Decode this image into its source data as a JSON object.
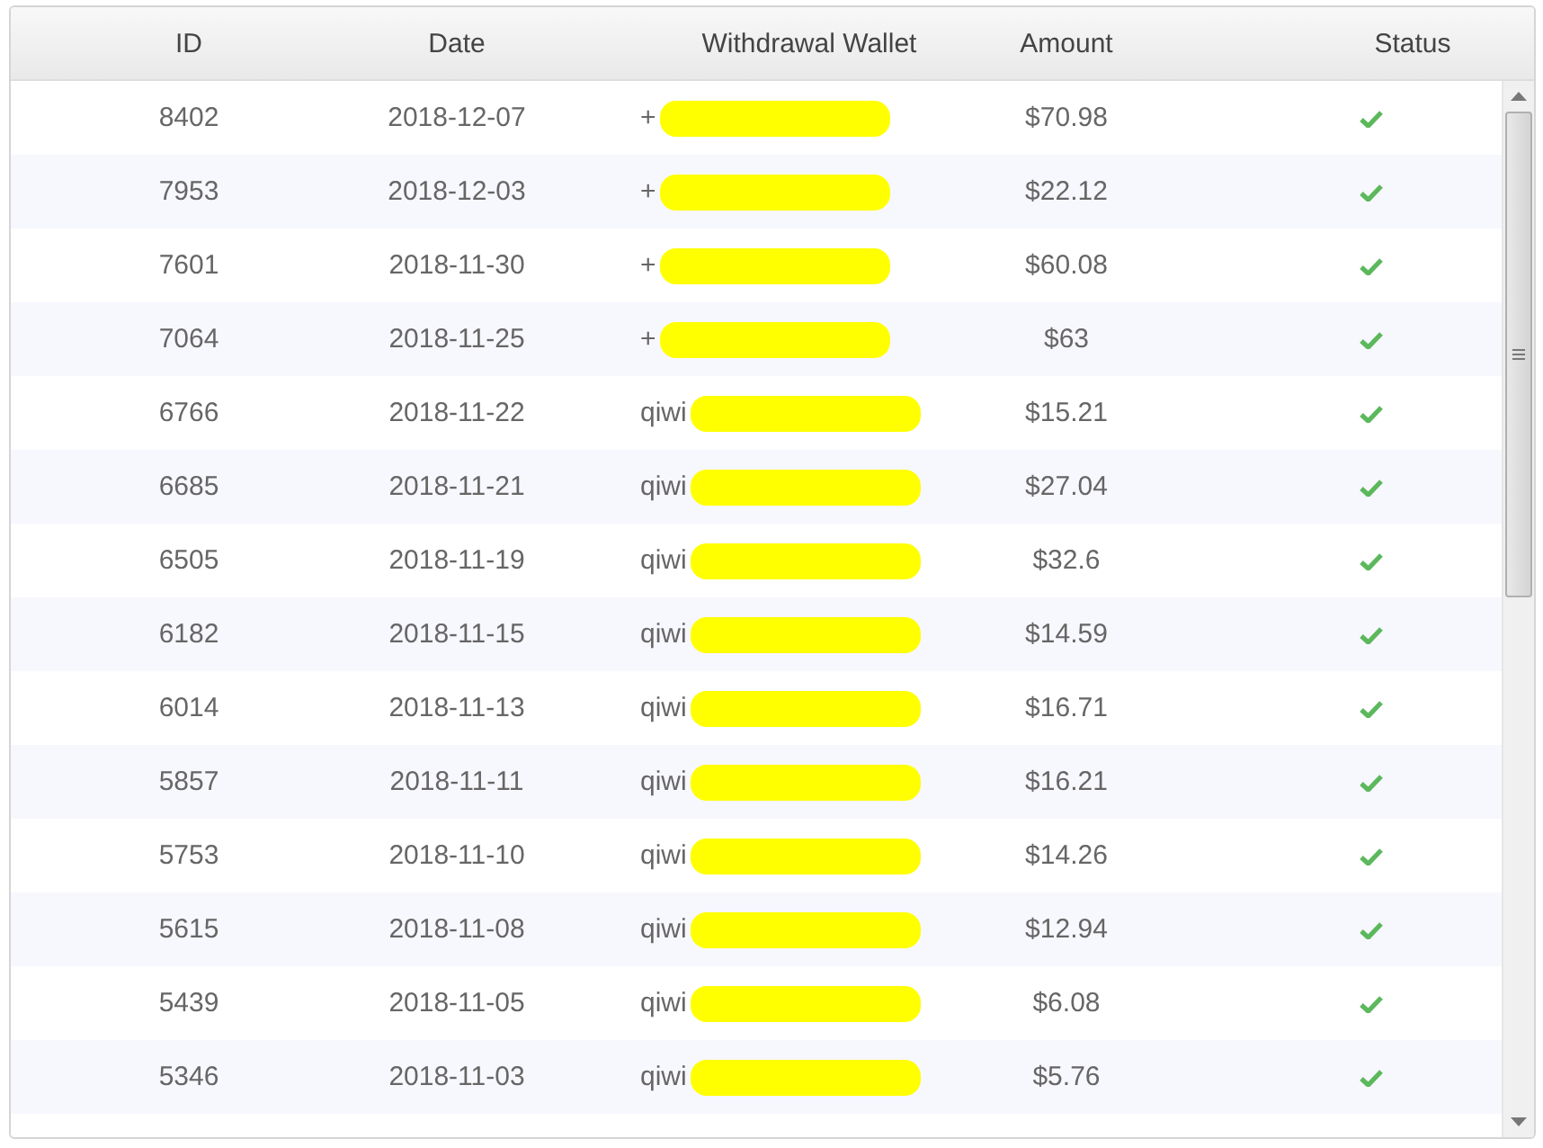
{
  "table": {
    "columns": [
      "ID",
      "Date",
      "Withdrawal Wallet",
      "Amount",
      "Status"
    ],
    "rows": [
      {
        "id": "8402",
        "date": "2018-12-07",
        "wallet": "+",
        "redacted": true,
        "amount": "$70.98",
        "completed": true
      },
      {
        "id": "7953",
        "date": "2018-12-03",
        "wallet": "+",
        "redacted": true,
        "amount": "$22.12",
        "completed": true
      },
      {
        "id": "7601",
        "date": "2018-11-30",
        "wallet": "+",
        "redacted": true,
        "amount": "$60.08",
        "completed": true
      },
      {
        "id": "7064",
        "date": "2018-11-25",
        "wallet": "+",
        "redacted": true,
        "amount": "$63",
        "completed": true
      },
      {
        "id": "6766",
        "date": "2018-11-22",
        "wallet": "qiwi",
        "redacted": true,
        "amount": "$15.21",
        "completed": true
      },
      {
        "id": "6685",
        "date": "2018-11-21",
        "wallet": "qiwi",
        "redacted": true,
        "amount": "$27.04",
        "completed": true
      },
      {
        "id": "6505",
        "date": "2018-11-19",
        "wallet": "qiwi",
        "redacted": true,
        "amount": "$32.6",
        "completed": true
      },
      {
        "id": "6182",
        "date": "2018-11-15",
        "wallet": "qiwi",
        "redacted": true,
        "amount": "$14.59",
        "completed": true
      },
      {
        "id": "6014",
        "date": "2018-11-13",
        "wallet": "qiwi",
        "redacted": true,
        "amount": "$16.71",
        "completed": true
      },
      {
        "id": "5857",
        "date": "2018-11-11",
        "wallet": "qiwi",
        "redacted": true,
        "amount": "$16.21",
        "completed": true
      },
      {
        "id": "5753",
        "date": "2018-11-10",
        "wallet": "qiwi",
        "redacted": true,
        "amount": "$14.26",
        "completed": true
      },
      {
        "id": "5615",
        "date": "2018-11-08",
        "wallet": "qiwi",
        "redacted": true,
        "amount": "$12.94",
        "completed": true
      },
      {
        "id": "5439",
        "date": "2018-11-05",
        "wallet": "qiwi",
        "redacted": true,
        "amount": "$6.08",
        "completed": true
      },
      {
        "id": "5346",
        "date": "2018-11-03",
        "wallet": "qiwi",
        "redacted": true,
        "amount": "$5.76",
        "completed": true
      }
    ]
  }
}
